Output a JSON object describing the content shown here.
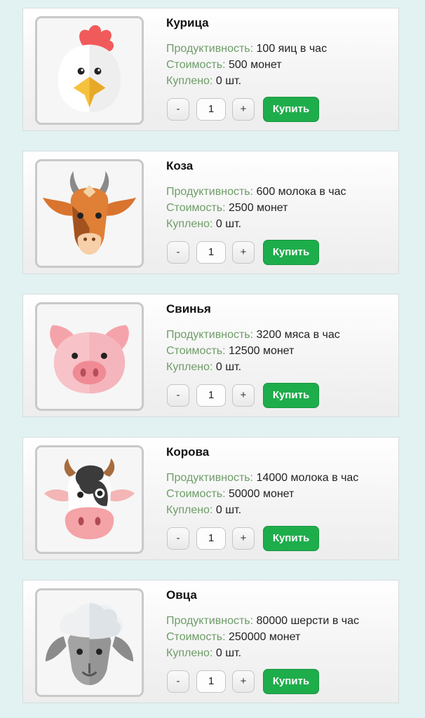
{
  "labels": {
    "productivity": "Продуктивность:",
    "cost": "Стоимость:",
    "bought": "Куплено:"
  },
  "controls": {
    "minus": "-",
    "plus": "+",
    "buy": "Купить"
  },
  "animals": [
    {
      "icon": "chicken-face-icon",
      "name": "Курица",
      "productivity": "100 яиц в час",
      "cost": "500 монет",
      "bought": "0 шт.",
      "quantity": "1"
    },
    {
      "icon": "goat-face-icon",
      "name": "Коза",
      "productivity": "600 молока в час",
      "cost": "2500 монет",
      "bought": "0 шт.",
      "quantity": "1"
    },
    {
      "icon": "pig-face-icon",
      "name": "Свинья",
      "productivity": "3200 мяса в час",
      "cost": "12500 монет",
      "bought": "0 шт.",
      "quantity": "1"
    },
    {
      "icon": "cow-face-icon",
      "name": "Корова",
      "productivity": "14000 молока в час",
      "cost": "50000 монет",
      "bought": "0 шт.",
      "quantity": "1"
    },
    {
      "icon": "sheep-face-icon",
      "name": "Овца",
      "productivity": "80000 шерсти в час",
      "cost": "250000 монет",
      "bought": "0 шт.",
      "quantity": "1"
    }
  ]
}
